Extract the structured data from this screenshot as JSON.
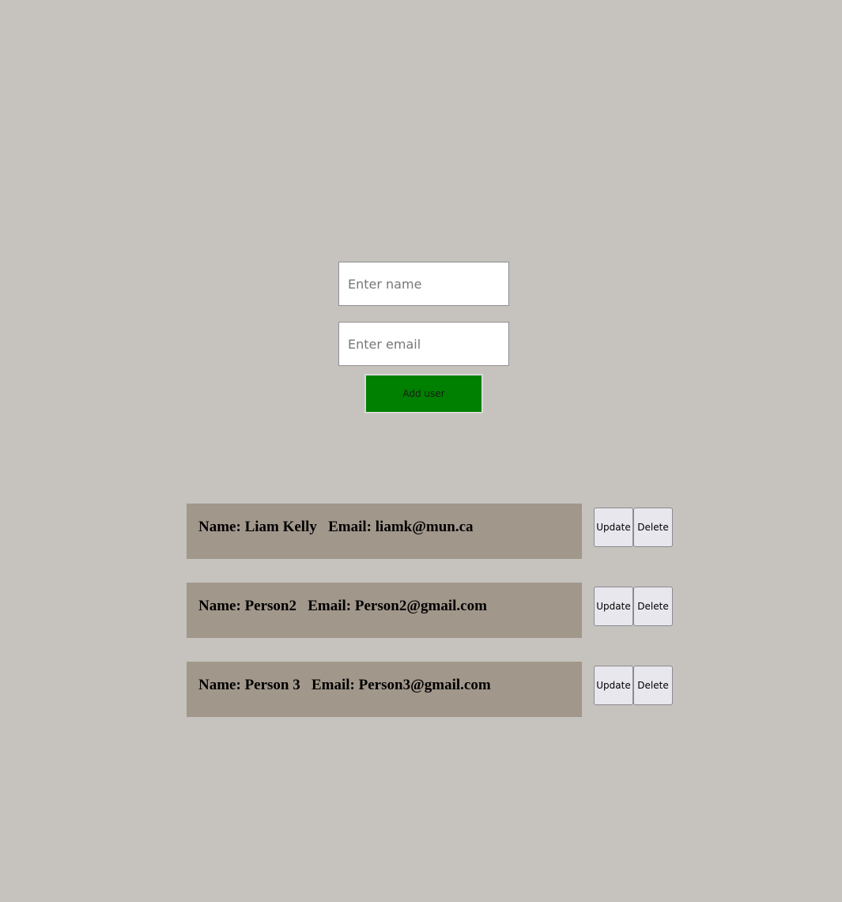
{
  "form": {
    "name_placeholder": "Enter name",
    "name_value": "",
    "email_placeholder": "Enter email",
    "email_value": "",
    "add_button_label": "Add user"
  },
  "users": [
    {
      "name_label": "Name:",
      "name": "Liam Kelly",
      "email_label": "Email:",
      "email": "liamk@mun.ca",
      "update_label": "Update",
      "delete_label": "Delete"
    },
    {
      "name_label": "Name:",
      "name": "Person2",
      "email_label": "Email:",
      "email": "Person2@gmail.com",
      "update_label": "Update",
      "delete_label": "Delete"
    },
    {
      "name_label": "Name:",
      "name": "Person 3",
      "email_label": "Email:",
      "email": "Person3@gmail.com",
      "update_label": "Update",
      "delete_label": "Delete"
    }
  ],
  "colors": {
    "background": "#c6c2bd",
    "add_button": "#008000",
    "user_card": "#a1978b"
  }
}
